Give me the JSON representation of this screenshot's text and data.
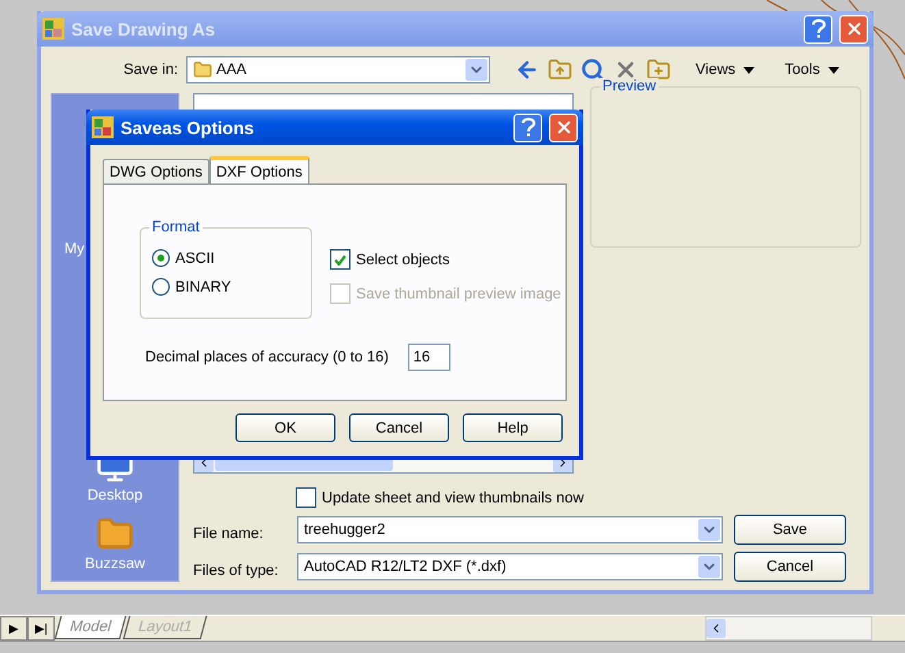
{
  "autocad": {
    "nav": [
      "▶",
      "▶|"
    ],
    "tabs": [
      {
        "label": "Model",
        "selected": true
      },
      {
        "label": "Layout1",
        "selected": false
      }
    ]
  },
  "save_dialog": {
    "title": "Save Drawing As",
    "save_in": {
      "label": "Save in:",
      "value": "AAA"
    },
    "menus": [
      "Views",
      "Tools"
    ],
    "sidebar": [
      {
        "label": "My",
        "kind": "partial"
      },
      {
        "label": "Desktop",
        "kind": "full"
      },
      {
        "label": "Buzzsaw",
        "kind": "full"
      }
    ],
    "preview": "Preview",
    "update_thumbnails": {
      "label": "Update sheet and view thumbnails now",
      "checked": false
    },
    "file_name": {
      "label": "File name:",
      "value": "treehugger2"
    },
    "file_type": {
      "label": "Files of type:",
      "value": "AutoCAD R12/LT2 DXF (*.dxf)"
    },
    "buttons": [
      "Save",
      "Cancel"
    ]
  },
  "options_dialog": {
    "title": "Saveas Options",
    "tabs": [
      {
        "label": "DWG Options",
        "selected": false
      },
      {
        "label": "DXF Options",
        "selected": true
      }
    ],
    "format": {
      "legend": "Format",
      "options": [
        {
          "label": "ASCII",
          "selected": true
        },
        {
          "label": "BINARY",
          "selected": false
        }
      ]
    },
    "checkboxes": [
      {
        "label": "Select objects",
        "checked": true,
        "disabled": false
      },
      {
        "label": "Save thumbnail preview image",
        "checked": false,
        "disabled": true
      }
    ],
    "accuracy": {
      "label": "Decimal places of accuracy (0 to 16)",
      "value": "16"
    },
    "buttons": [
      "OK",
      "Cancel",
      "Help"
    ]
  }
}
